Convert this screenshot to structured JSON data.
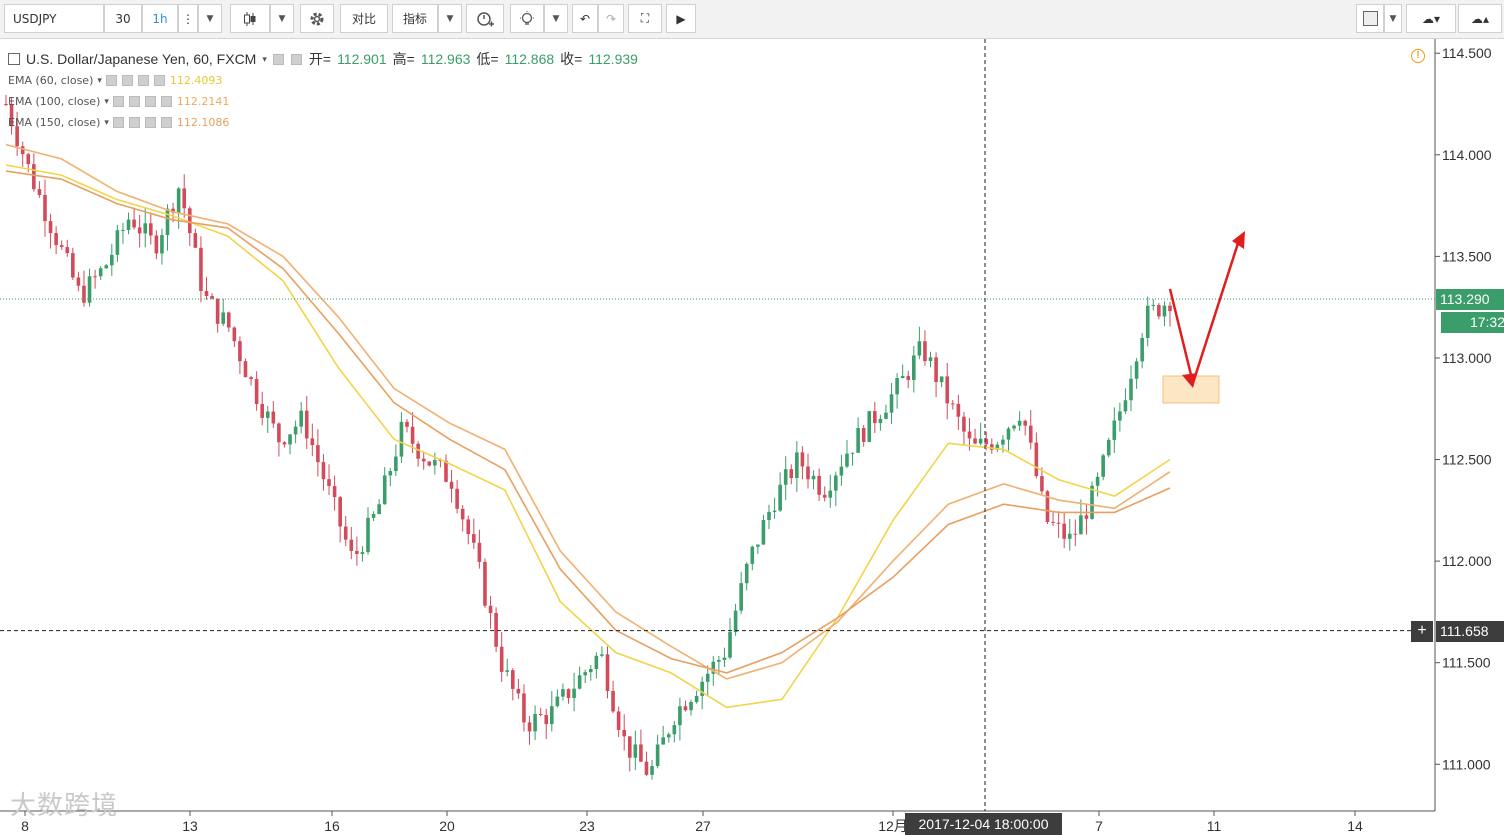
{
  "toolbar": {
    "symbol": "USDJPY",
    "interval_value": "30",
    "interval_label": "1h",
    "compare_label": "对比",
    "indicators_label": "指标"
  },
  "legend": {
    "title": "U.S. Dollar/Japanese Yen, 60, FXCM",
    "open_label": "开=",
    "open": "112.901",
    "high_label": "高=",
    "high": "112.963",
    "low_label": "低=",
    "low": "112.868",
    "close_label": "收=",
    "close": "112.939",
    "indicators": [
      {
        "label": "EMA (60, close)",
        "value": "112.4093",
        "color": "#e8c832"
      },
      {
        "label": "EMA (100, close)",
        "value": "112.2141",
        "color": "#f0a85a"
      },
      {
        "label": "EMA (150, close)",
        "value": "112.1086",
        "color": "#e8a060"
      }
    ]
  },
  "price_axis": {
    "ticks": [
      "114.500",
      "114.000",
      "113.500",
      "113.000",
      "112.500",
      "112.000",
      "111.500",
      "111.000"
    ],
    "current_price": "113.290",
    "countdown": "17:32",
    "crosshair_price": "111.658"
  },
  "time_axis": {
    "ticks": [
      "8",
      "13",
      "16",
      "20",
      "23",
      "27",
      "12月",
      "7",
      "11",
      "14"
    ],
    "crosshair_time": "2017-12-04 18:00:00"
  },
  "watermark": "大数跨境",
  "colors": {
    "up": "#3a9d6a",
    "down": "#d24b5a",
    "ema60": "#f2d44a",
    "ema100": "#f0b070",
    "ema150": "#e8a060",
    "annotation_arrow": "#e01e1e",
    "annotation_box": "#fde6c4"
  },
  "chart_data": {
    "type": "candlestick",
    "ylim": [
      110.77,
      114.57
    ],
    "y_ticks": [
      114.5,
      114.0,
      113.5,
      113.0,
      112.5,
      112.0,
      111.5,
      111.0
    ],
    "x_ticks": [
      "8",
      "13",
      "16",
      "20",
      "23",
      "27",
      "12月",
      "7",
      "11",
      "14"
    ],
    "last_price": 113.29,
    "crosshair": {
      "time": "2017-12-04 18:00:00",
      "price": 111.658
    },
    "ema60_values": [
      113.95,
      113.9,
      113.78,
      113.7,
      113.6,
      113.38,
      112.95,
      112.6,
      112.48,
      112.35,
      111.8,
      111.55,
      111.45,
      111.28,
      111.32,
      111.72,
      112.2,
      112.58,
      112.55,
      112.4,
      112.32,
      112.5
    ],
    "ema100_values": [
      114.05,
      113.98,
      113.82,
      113.72,
      113.66,
      113.5,
      113.2,
      112.85,
      112.68,
      112.55,
      112.05,
      111.75,
      111.58,
      111.42,
      111.5,
      111.7,
      112.0,
      112.28,
      112.38,
      112.3,
      112.26,
      112.44
    ],
    "ema150_values": [
      113.92,
      113.88,
      113.76,
      113.68,
      113.64,
      113.44,
      113.12,
      112.78,
      112.6,
      112.45,
      111.96,
      111.66,
      111.52,
      111.45,
      111.55,
      111.72,
      111.92,
      112.18,
      112.28,
      112.24,
      112.24,
      112.36
    ],
    "price_path": [
      114.25,
      113.9,
      113.6,
      113.3,
      113.45,
      113.7,
      113.55,
      113.85,
      113.3,
      113.15,
      112.85,
      112.6,
      112.7,
      112.35,
      112.0,
      112.25,
      112.65,
      112.5,
      112.4,
      112.0,
      111.5,
      111.2,
      111.25,
      111.4,
      111.55,
      111.1,
      110.95,
      111.25,
      111.4,
      111.55,
      112.0,
      112.3,
      112.5,
      112.35,
      112.55,
      112.7,
      112.85,
      113.05,
      112.8,
      112.55,
      112.6,
      112.75,
      112.2,
      112.1,
      112.35,
      112.75,
      113.2,
      113.29
    ]
  }
}
